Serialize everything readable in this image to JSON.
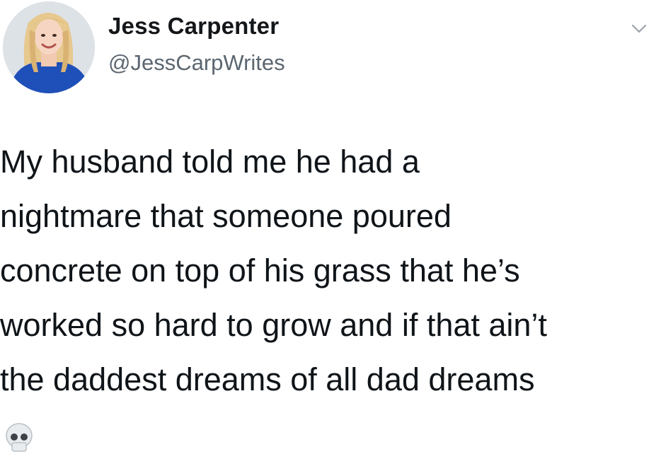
{
  "tweet": {
    "author": {
      "display_name": "Jess Carpenter",
      "handle": "@JessCarpWrites",
      "avatar_icon": "profile-photo"
    },
    "menu_icon": "chevron-down-icon",
    "text_lines": [
      "My husband told me he had a",
      "nightmare that someone poured",
      "concrete on top of his grass that he’s",
      "worked so hard to grow and if that ain’t",
      "the daddest dreams of all dad dreams"
    ],
    "trailing_emoji": "skull-emoji"
  },
  "colors": {
    "background": "#ffffff",
    "name": "#14171a",
    "handle": "#5b6670",
    "text": "#0f1419",
    "avatar_shirt": "#1f4fb8",
    "avatar_hair": "#e7c88e"
  }
}
